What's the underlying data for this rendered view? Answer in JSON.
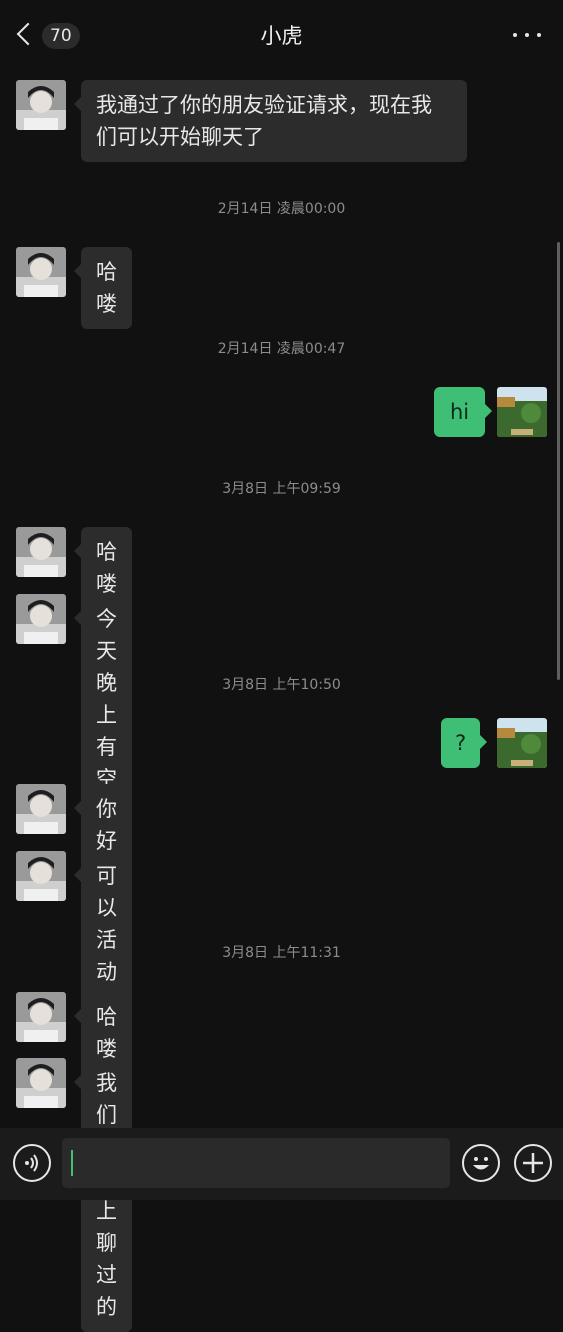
{
  "header": {
    "unread_count": "70",
    "title": "小虎"
  },
  "messages": [
    {
      "type": "msg",
      "side": "left",
      "text": "我通过了你的朋友验证请求，现在我们可以开始聊天了"
    },
    {
      "type": "time",
      "text": "2月14日 凌晨00:00"
    },
    {
      "type": "msg",
      "side": "left",
      "text": "哈喽"
    },
    {
      "type": "time",
      "text": "2月14日 凌晨00:47"
    },
    {
      "type": "msg",
      "side": "right",
      "text": "hi"
    },
    {
      "type": "time",
      "text": "3月8日 上午09:59"
    },
    {
      "type": "msg",
      "side": "left",
      "text": "哈喽"
    },
    {
      "type": "msg",
      "side": "left",
      "text": "今天晚上有空吗"
    },
    {
      "type": "time",
      "text": "3月8日 上午10:50"
    },
    {
      "type": "msg",
      "side": "right",
      "text": "?"
    },
    {
      "type": "msg",
      "side": "left",
      "text": "你好"
    },
    {
      "type": "msg",
      "side": "left",
      "text": "可以活动吗"
    },
    {
      "type": "time",
      "text": "3月8日 上午11:31"
    },
    {
      "type": "msg",
      "side": "left",
      "text": "哈喽"
    },
    {
      "type": "msg",
      "side": "left",
      "text": "我们在推上聊过的"
    }
  ],
  "input": {
    "value": ""
  },
  "colors": {
    "background": "#111111",
    "bubble_other": "#2c2c2c",
    "bubble_me": "#3fbf75",
    "timestamp": "#8c8c8c"
  },
  "icons": {
    "back": "back-chevron-icon",
    "more": "more-icon",
    "voice": "voice-icon",
    "emoji": "emoji-icon",
    "plus": "plus-icon"
  }
}
